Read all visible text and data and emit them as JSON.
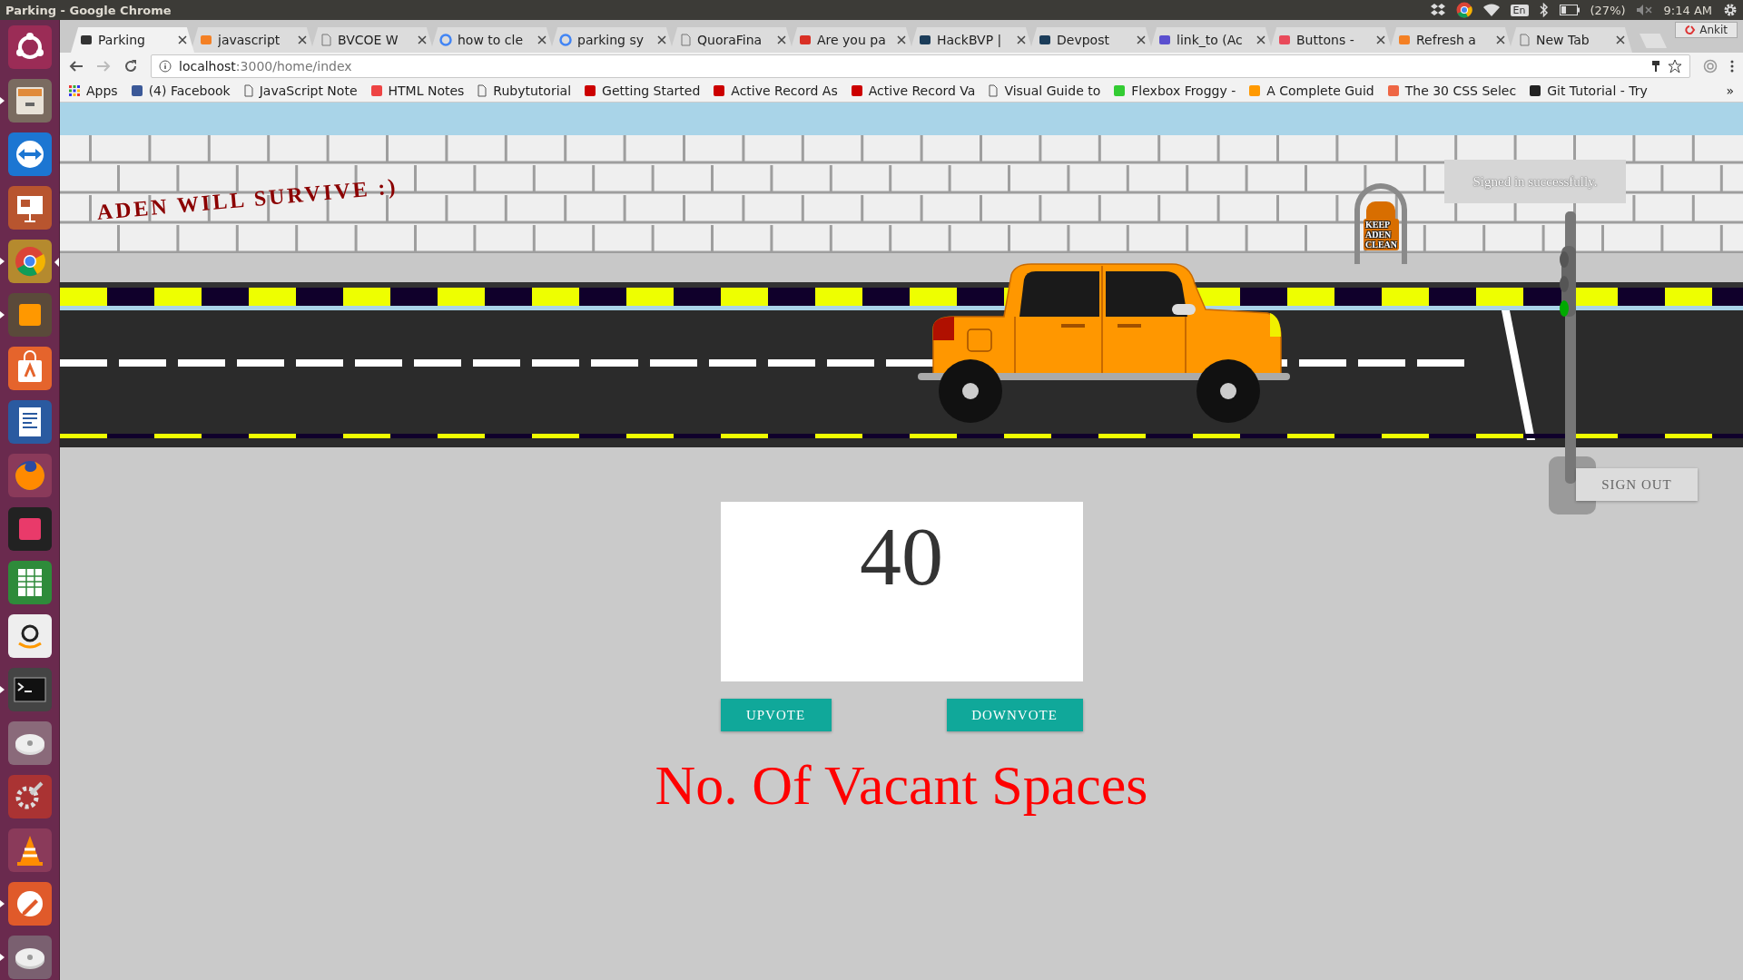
{
  "top_panel": {
    "title": "Parking - Google Chrome",
    "keyboard": "En",
    "battery": "(27%)",
    "time": "9:14 AM"
  },
  "launcher": [
    {
      "kind": "ubuntu",
      "running": false,
      "focused": false
    },
    {
      "kind": "files",
      "running": true,
      "focused": false
    },
    {
      "kind": "remote",
      "running": false,
      "focused": false
    },
    {
      "kind": "slides",
      "running": false,
      "focused": false
    },
    {
      "kind": "chrome",
      "running": true,
      "focused": true
    },
    {
      "kind": "editor",
      "running": true,
      "focused": false
    },
    {
      "kind": "store",
      "running": false,
      "focused": false
    },
    {
      "kind": "writer",
      "running": false,
      "focused": false
    },
    {
      "kind": "firefox",
      "running": false,
      "focused": false
    },
    {
      "kind": "ide",
      "running": false,
      "focused": false
    },
    {
      "kind": "calc",
      "running": false,
      "focused": false
    },
    {
      "kind": "shop",
      "running": false,
      "focused": false
    },
    {
      "kind": "terminal",
      "running": true,
      "focused": false
    },
    {
      "kind": "disk",
      "running": false,
      "focused": false
    },
    {
      "kind": "settings",
      "running": false,
      "focused": false
    },
    {
      "kind": "cone",
      "running": false,
      "focused": false
    },
    {
      "kind": "pen",
      "running": true,
      "focused": false
    },
    {
      "kind": "drive",
      "running": true,
      "focused": false
    }
  ],
  "tabs": [
    {
      "label": "Parking",
      "selected": true
    },
    {
      "label": "javascript",
      "selected": false
    },
    {
      "label": "BVCOE W",
      "selected": false
    },
    {
      "label": "how to cle",
      "selected": false
    },
    {
      "label": "parking sy",
      "selected": false
    },
    {
      "label": "QuoraFina",
      "selected": false
    },
    {
      "label": "Are you pa",
      "selected": false
    },
    {
      "label": "HackBVP |",
      "selected": false
    },
    {
      "label": "Devpost",
      "selected": false
    },
    {
      "label": "link_to (Ac",
      "selected": false
    },
    {
      "label": "Buttons -",
      "selected": false
    },
    {
      "label": "Refresh a",
      "selected": false
    },
    {
      "label": "New Tab",
      "selected": false
    }
  ],
  "profile": "Ankit",
  "address_bar": {
    "host": "localhost",
    "path": ":3000/home/index"
  },
  "bookmarks": [
    "Apps",
    "(4) Facebook",
    "JavaScript Note",
    "HTML Notes",
    "Rubytutorial",
    "Getting Started",
    "Active Record As",
    "Active Record Va",
    "Visual Guide to",
    "Flexbox Froggy -",
    "A Complete Guid",
    "The 30 CSS Selec",
    "Git Tutorial - Try"
  ],
  "bookmarks_more": "»",
  "page": {
    "banner": "ADEN WILL SURVIVE :)",
    "bin_label": [
      "KEEP",
      "ADEN",
      "CLEAN"
    ],
    "flash": "Signed in successfully.",
    "traffic_light": {
      "lights": [
        {
          "on": false
        },
        {
          "on": false
        },
        {
          "on": true
        }
      ]
    },
    "sign_out": "SIGN OUT",
    "count": "40",
    "upvote": "UPVOTE",
    "downvote": "DOWNVOTE",
    "caption": "No. Of Vacant Spaces"
  }
}
